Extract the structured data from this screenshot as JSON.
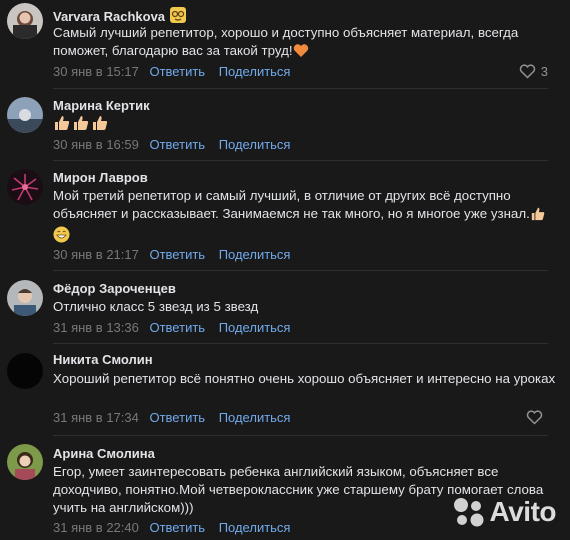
{
  "comments": [
    {
      "author": "Varvara Rachkova",
      "text": "Самый лучший репетитор, хорошо и доступно объясняет материал, всегда поможет, благодарю вас за такой труд!",
      "date": "30 янв в 15:17",
      "reply": "Ответить",
      "share": "Поделиться",
      "likes": "3"
    },
    {
      "author": "Марина Кертик",
      "text": "",
      "date": "30 янв в 16:59",
      "reply": "Ответить",
      "share": "Поделиться",
      "likes": ""
    },
    {
      "author": "Мирон Лавров",
      "text": "Мой третий репетитор и самый лучший, в отличие от других всё доступно объясняет и рассказывает. Занимаемся не так много, но я многое уже узнал.",
      "date": "30 янв в 21:17",
      "reply": "Ответить",
      "share": "Поделиться",
      "likes": ""
    },
    {
      "author": "Фёдор Зароченцев",
      "text": "Отлично класс 5 звезд из 5 звезд",
      "date": "31 янв в 13:36",
      "reply": "Ответить",
      "share": "Поделиться",
      "likes": ""
    },
    {
      "author": "Никита Смолин",
      "text": "Хороший репетитор всё понятно очень хорошо объясняет и интересно на уроках",
      "date": "31 янв в 17:34",
      "reply": "Ответить",
      "share": "Поделиться",
      "likes": ""
    },
    {
      "author": "Арина Смолина",
      "text": "Егор, умеет заинтересовать ребенка английский языком, объясняет все доходчиво, понятно.Мой четвероклассник уже старшему брату помогает слова учить на английском)))",
      "date": "31 янв в 22:40",
      "reply": "Ответить",
      "share": "Поделиться",
      "likes": ""
    }
  ],
  "watermark": "Avito",
  "colors": {
    "background": "#19191a",
    "text": "#e1e3e6",
    "meta": "#76787a",
    "link": "#71aaeb",
    "divider": "#2e2f30"
  },
  "icons": {
    "like": "heart-icon",
    "thumbs": "thumbs-up-emoji",
    "heart_emoji": "orange-heart-emoji",
    "grin": "grinning-emoji"
  }
}
